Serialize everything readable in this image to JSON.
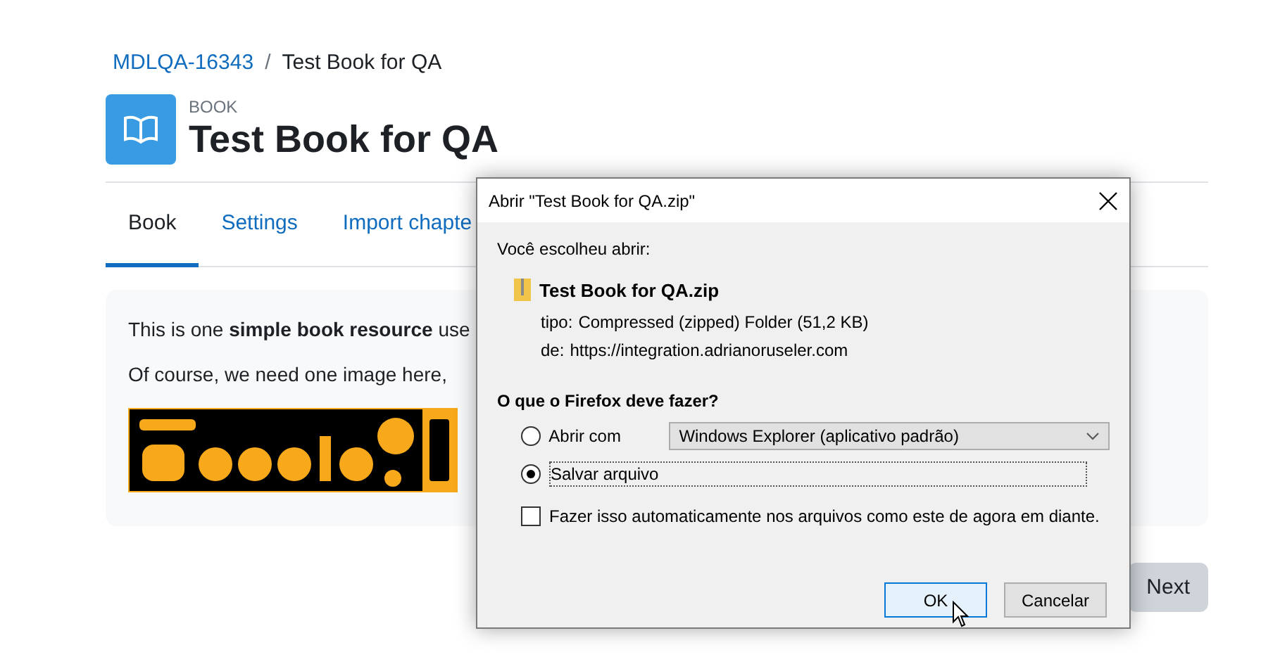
{
  "breadcrumb_separator": "/",
  "breadcrumb": [
    {
      "label": "MDLQA-16343",
      "kind": "link"
    },
    {
      "label": "Test Book for QA",
      "kind": "current"
    }
  ],
  "header": {
    "module_type": "BOOK",
    "title": "Test Book for QA"
  },
  "tabs": [
    {
      "label": "Book",
      "selected": true
    },
    {
      "label": "Settings",
      "selected": false
    },
    {
      "label": "Import chapte",
      "selected": false
    }
  ],
  "content": {
    "paragraphs": [
      "This is one **simple book resource** use",
      "Of course, we need one image here,"
    ],
    "image": {
      "kind": "picture"
    }
  },
  "next_button": "Next",
  "dialog": {
    "title": "Abrir \"Test Book for QA.zip\"",
    "intro": "Você escolheu abrir:",
    "file_name": "Test Book for QA.zip",
    "details": [
      {
        "label": "tipo:",
        "value": "Compressed (zipped) Folder (51,2 KB)"
      },
      {
        "label": "de:",
        "value": "https://integration.adrianoruseler.com"
      }
    ],
    "question": "O que o Firefox deve fazer?",
    "options": [
      {
        "label": "Abrir com",
        "selected": false,
        "kind": "open_with",
        "app": "Windows Explorer (aplicativo padrão)"
      },
      {
        "label": "Salvar arquivo",
        "selected": true,
        "kind": "save"
      }
    ],
    "remember": {
      "label": "Fazer isso automaticamente nos arquivos como este de agora em diante.",
      "checked": false
    },
    "buttons": [
      {
        "label": "OK",
        "kind": "default"
      },
      {
        "label": "Cancelar",
        "kind": "normal"
      }
    ]
  }
}
